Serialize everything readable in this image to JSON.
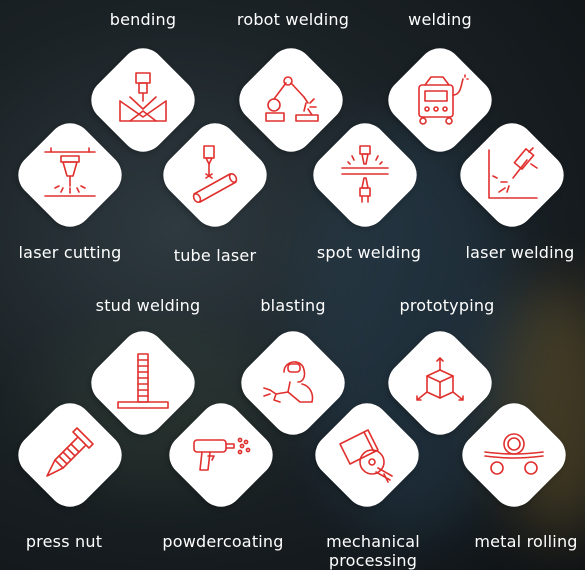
{
  "services_top": [
    "bending",
    "robot welding",
    "welding",
    "laser cutting",
    "tube laser",
    "spot welding",
    "laser welding"
  ],
  "services_bottom": [
    "stud welding",
    "blasting",
    "prototyping",
    "press nut",
    "powdercoating",
    "mechanical processing",
    "metal rolling"
  ],
  "labels": {
    "mechanical_line1": "mechanical",
    "mechanical_line2": "processing"
  },
  "colors": {
    "tile": "#ffffff",
    "icon": "#e0302e",
    "text": "#ffffff"
  },
  "icons": [
    "bending-icon",
    "robot-welding-icon",
    "welding-machine-icon",
    "laser-cutting-icon",
    "tube-laser-icon",
    "spot-welding-icon",
    "laser-welding-icon",
    "stud-welding-icon",
    "blasting-icon",
    "prototyping-icon",
    "press-nut-icon",
    "powdercoating-icon",
    "mechanical-processing-icon",
    "metal-rolling-icon"
  ]
}
